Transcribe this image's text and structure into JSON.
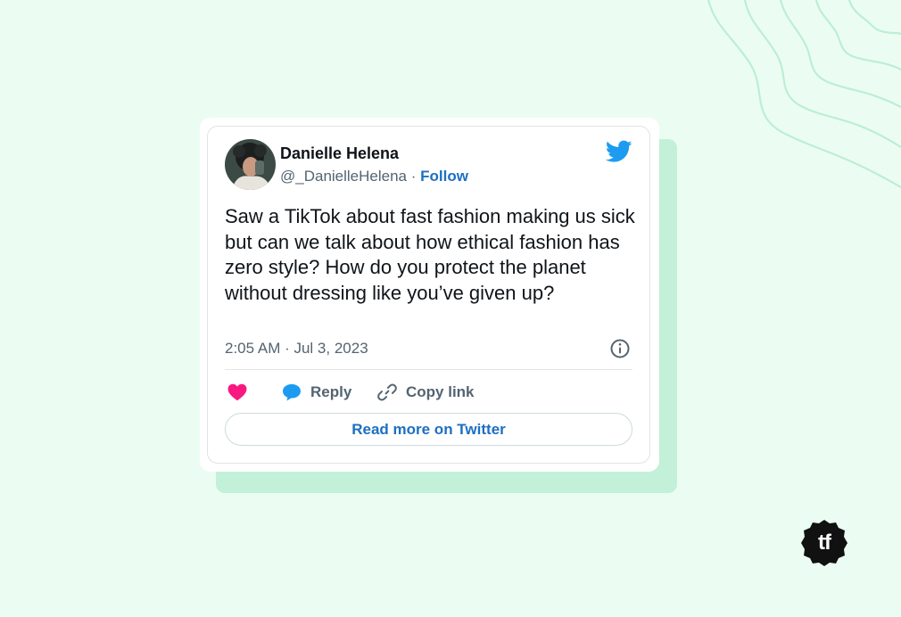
{
  "colors": {
    "background": "#ebfdf3",
    "accent_card": "#c3f0d8",
    "twitter_blue": "#1d9bf0",
    "link_blue": "#1d6fc2",
    "heart": "#f91880",
    "text_primary": "#0f1419",
    "text_secondary": "#536471"
  },
  "tweet": {
    "author": {
      "name": "Danielle Helena",
      "handle": "@_DanielleHelena",
      "separator": "·",
      "follow_label": "Follow",
      "avatar_icon": "avatar-photo"
    },
    "platform_icon": "twitter-bird-icon",
    "text": "Saw a TikTok about fast fashion making us sick but can we talk about how ethical fashion has zero style? How do you protect the planet without dressing like you’ve given up?",
    "timestamp": "2:05 AM · Jul 3, 2023",
    "info_icon": "info-icon",
    "actions": {
      "like_icon": "heart-icon",
      "reply_label": "Reply",
      "reply_icon": "speech-bubble-icon",
      "copy_label": "Copy link",
      "copy_icon": "link-icon"
    },
    "read_more_label": "Read more on Twitter"
  },
  "branding": {
    "badge_text": "tf",
    "badge_icon": "tf-logo-badge"
  }
}
